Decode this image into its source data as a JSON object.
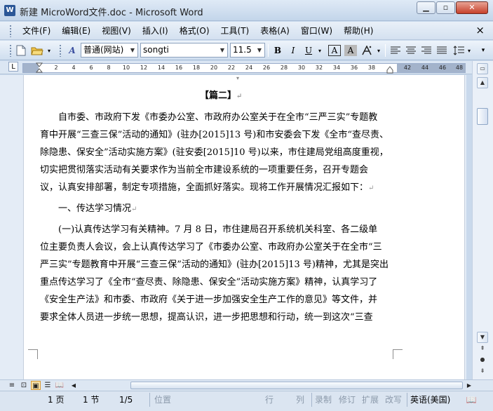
{
  "window": {
    "title": "新建 MicroWord文件.doc - Microsoft Word",
    "icon": "W"
  },
  "menu": {
    "items": [
      "文件(F)",
      "编辑(E)",
      "视图(V)",
      "插入(I)",
      "格式(O)",
      "工具(T)",
      "表格(A)",
      "窗口(W)",
      "帮助(H)"
    ],
    "close": "×"
  },
  "toolbar": {
    "style_value": "普通(网站)",
    "font_value": "songti",
    "size_value": "11.5",
    "bold": "B",
    "italic": "I",
    "underline": "U",
    "char_border": "A",
    "char_shading": "A"
  },
  "ruler": {
    "ticks": [
      "2",
      "4",
      "6",
      "8",
      "10",
      "12",
      "14",
      "16",
      "18",
      "20",
      "22",
      "24",
      "26",
      "28",
      "30",
      "32",
      "34",
      "36",
      "38",
      "42",
      "44",
      "46",
      "48"
    ]
  },
  "document": {
    "heading": "【篇二】",
    "lines": [
      "自市委、市政府下发《市委办公室、市政府办公室关于在全市“三严三实”专题教",
      "育中开展“三查三保”活动的通知》(驻办[2015]13 号)和市安委会下发《全市“查尽责、",
      "除隐患、保安全”活动实施方案》(驻安委[2015]10 号)以来，市住建局党组高度重视，",
      "切实把贯彻落实活动有关要求作为当前全市建设系统的一项重要任务，召开专题会",
      "议，认真安排部署，制定专项措施，全面抓好落实。现将工作开展情况汇报如下：",
      "一、传达学习情况",
      "(一)认真传达学习有关精神。7 月 8 日，市住建局召开系统机关科室、各二级单",
      "位主要负责人会议，会上认真传达学习了《市委办公室、市政府办公室关于在全市“三",
      "严三实”专题教育中开展“三查三保”活动的通知》(驻办[2015]13 号)精神，尤其是突出",
      "重点传达学习了《全市“查尽责、除隐患、保安全”活动实施方案》精神，认真学习了",
      "《安全生产法》和市委、市政府《关于进一步加强安全生产工作的意见》等文件，并",
      "要求全体人员进一步统一思想，提高认识，进一步把思想和行动，统一到这次“三查"
    ],
    "return_mark": "↵"
  },
  "status": {
    "page": "1 页",
    "section": "1 节",
    "page_of": "1/5",
    "position": "位置",
    "line": "行",
    "column": "列",
    "rec": "录制",
    "trk": "修订",
    "ext": "扩展",
    "ovr": "改写",
    "language": "英语(美国)"
  }
}
